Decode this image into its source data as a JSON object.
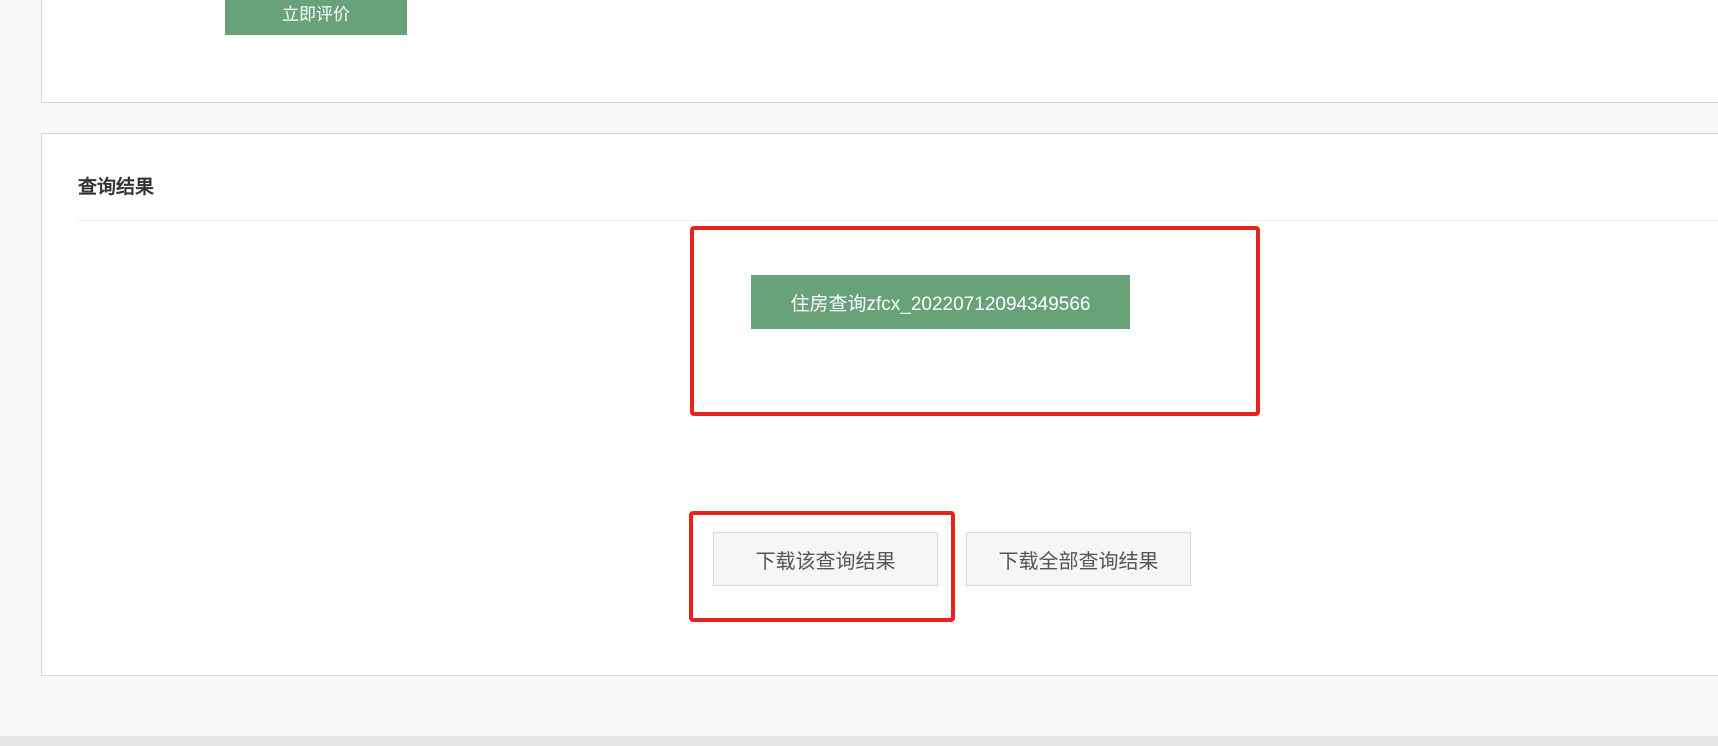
{
  "top_panel": {
    "rate_button_label": "立即评价"
  },
  "result_panel": {
    "title": "查询结果",
    "file_button_label": "住房查询zfcx_20220712094349566",
    "download_one_label": "下载该查询结果",
    "download_all_label": "下载全部查询结果"
  },
  "colors": {
    "primary_green": "#67a278",
    "highlight_red": "#e8231d",
    "page_background": "#f9f9f9"
  }
}
